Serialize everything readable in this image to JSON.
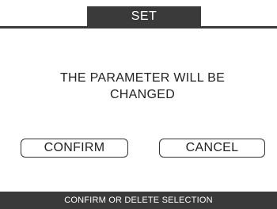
{
  "header": {
    "title": "SET"
  },
  "dialog": {
    "message_line1": "THE PARAMETER WILL BE",
    "message_line2": "CHANGED",
    "confirm_label": "CONFIRM",
    "cancel_label": "CANCEL"
  },
  "footer": {
    "hint": "CONFIRM OR DELETE SELECTION"
  },
  "colors": {
    "bar_background": "#3a3a3a",
    "screen_background": "#ffffff",
    "text": "#222222"
  }
}
